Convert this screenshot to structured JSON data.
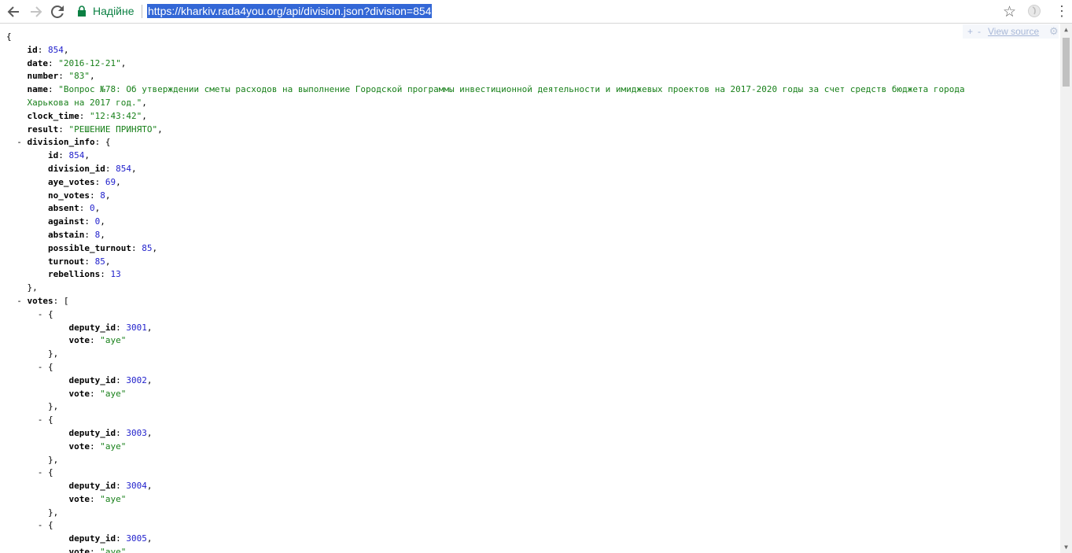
{
  "browser": {
    "secure_label": "Надійне",
    "url": "https://kharkiv.rada4you.org/api/division.json?division=854"
  },
  "viewsource": {
    "plus": "+",
    "minus": "-",
    "link": "View source"
  },
  "json_lines": [
    [
      [
        "p",
        "{"
      ]
    ],
    [
      [
        "p",
        "    "
      ],
      [
        "k",
        "id"
      ],
      [
        "p",
        ": "
      ],
      [
        "n",
        "854"
      ],
      [
        "p",
        ","
      ]
    ],
    [
      [
        "p",
        "    "
      ],
      [
        "k",
        "date"
      ],
      [
        "p",
        ": "
      ],
      [
        "s",
        "\"2016-12-21\""
      ],
      [
        "p",
        ","
      ]
    ],
    [
      [
        "p",
        "    "
      ],
      [
        "k",
        "number"
      ],
      [
        "p",
        ": "
      ],
      [
        "s",
        "\"83\""
      ],
      [
        "p",
        ","
      ]
    ],
    [
      [
        "p",
        "    "
      ],
      [
        "k",
        "name"
      ],
      [
        "p",
        ": "
      ],
      [
        "s",
        "\"Вопрос №78: Об утверждении сметы расходов на выполнение Городской программы инвестиционной деятельности и имиджевых проектов на 2017-2020 годы за счет средств бюджета города"
      ]
    ],
    [
      [
        "p",
        "    "
      ],
      [
        "s",
        "Харькова на 2017 год.\""
      ],
      [
        "p",
        ","
      ]
    ],
    [
      [
        "p",
        "    "
      ],
      [
        "k",
        "clock_time"
      ],
      [
        "p",
        ": "
      ],
      [
        "s",
        "\"12:43:42\""
      ],
      [
        "p",
        ","
      ]
    ],
    [
      [
        "p",
        "    "
      ],
      [
        "k",
        "result"
      ],
      [
        "p",
        ": "
      ],
      [
        "s",
        "\"РЕШЕНИЕ ПРИНЯТО\""
      ],
      [
        "p",
        ","
      ]
    ],
    [
      [
        "p",
        "  "
      ],
      [
        "t",
        "-"
      ],
      [
        "p",
        " "
      ],
      [
        "k",
        "division_info"
      ],
      [
        "p",
        ": {"
      ]
    ],
    [
      [
        "p",
        "        "
      ],
      [
        "k",
        "id"
      ],
      [
        "p",
        ": "
      ],
      [
        "n",
        "854"
      ],
      [
        "p",
        ","
      ]
    ],
    [
      [
        "p",
        "        "
      ],
      [
        "k",
        "division_id"
      ],
      [
        "p",
        ": "
      ],
      [
        "n",
        "854"
      ],
      [
        "p",
        ","
      ]
    ],
    [
      [
        "p",
        "        "
      ],
      [
        "k",
        "aye_votes"
      ],
      [
        "p",
        ": "
      ],
      [
        "n",
        "69"
      ],
      [
        "p",
        ","
      ]
    ],
    [
      [
        "p",
        "        "
      ],
      [
        "k",
        "no_votes"
      ],
      [
        "p",
        ": "
      ],
      [
        "n",
        "8"
      ],
      [
        "p",
        ","
      ]
    ],
    [
      [
        "p",
        "        "
      ],
      [
        "k",
        "absent"
      ],
      [
        "p",
        ": "
      ],
      [
        "n",
        "0"
      ],
      [
        "p",
        ","
      ]
    ],
    [
      [
        "p",
        "        "
      ],
      [
        "k",
        "against"
      ],
      [
        "p",
        ": "
      ],
      [
        "n",
        "0"
      ],
      [
        "p",
        ","
      ]
    ],
    [
      [
        "p",
        "        "
      ],
      [
        "k",
        "abstain"
      ],
      [
        "p",
        ": "
      ],
      [
        "n",
        "8"
      ],
      [
        "p",
        ","
      ]
    ],
    [
      [
        "p",
        "        "
      ],
      [
        "k",
        "possible_turnout"
      ],
      [
        "p",
        ": "
      ],
      [
        "n",
        "85"
      ],
      [
        "p",
        ","
      ]
    ],
    [
      [
        "p",
        "        "
      ],
      [
        "k",
        "turnout"
      ],
      [
        "p",
        ": "
      ],
      [
        "n",
        "85"
      ],
      [
        "p",
        ","
      ]
    ],
    [
      [
        "p",
        "        "
      ],
      [
        "k",
        "rebellions"
      ],
      [
        "p",
        ": "
      ],
      [
        "n",
        "13"
      ]
    ],
    [
      [
        "p",
        "    },"
      ]
    ],
    [
      [
        "p",
        "  "
      ],
      [
        "t",
        "-"
      ],
      [
        "p",
        " "
      ],
      [
        "k",
        "votes"
      ],
      [
        "p",
        ": ["
      ]
    ],
    [
      [
        "p",
        "      "
      ],
      [
        "t",
        "-"
      ],
      [
        "p",
        " {"
      ]
    ],
    [
      [
        "p",
        "            "
      ],
      [
        "k",
        "deputy_id"
      ],
      [
        "p",
        ": "
      ],
      [
        "n",
        "3001"
      ],
      [
        "p",
        ","
      ]
    ],
    [
      [
        "p",
        "            "
      ],
      [
        "k",
        "vote"
      ],
      [
        "p",
        ": "
      ],
      [
        "s",
        "\"aye\""
      ]
    ],
    [
      [
        "p",
        "        },"
      ]
    ],
    [
      [
        "p",
        "      "
      ],
      [
        "t",
        "-"
      ],
      [
        "p",
        " {"
      ]
    ],
    [
      [
        "p",
        "            "
      ],
      [
        "k",
        "deputy_id"
      ],
      [
        "p",
        ": "
      ],
      [
        "n",
        "3002"
      ],
      [
        "p",
        ","
      ]
    ],
    [
      [
        "p",
        "            "
      ],
      [
        "k",
        "vote"
      ],
      [
        "p",
        ": "
      ],
      [
        "s",
        "\"aye\""
      ]
    ],
    [
      [
        "p",
        "        },"
      ]
    ],
    [
      [
        "p",
        "      "
      ],
      [
        "t",
        "-"
      ],
      [
        "p",
        " {"
      ]
    ],
    [
      [
        "p",
        "            "
      ],
      [
        "k",
        "deputy_id"
      ],
      [
        "p",
        ": "
      ],
      [
        "n",
        "3003"
      ],
      [
        "p",
        ","
      ]
    ],
    [
      [
        "p",
        "            "
      ],
      [
        "k",
        "vote"
      ],
      [
        "p",
        ": "
      ],
      [
        "s",
        "\"aye\""
      ]
    ],
    [
      [
        "p",
        "        },"
      ]
    ],
    [
      [
        "p",
        "      "
      ],
      [
        "t",
        "-"
      ],
      [
        "p",
        " {"
      ]
    ],
    [
      [
        "p",
        "            "
      ],
      [
        "k",
        "deputy_id"
      ],
      [
        "p",
        ": "
      ],
      [
        "n",
        "3004"
      ],
      [
        "p",
        ","
      ]
    ],
    [
      [
        "p",
        "            "
      ],
      [
        "k",
        "vote"
      ],
      [
        "p",
        ": "
      ],
      [
        "s",
        "\"aye\""
      ]
    ],
    [
      [
        "p",
        "        },"
      ]
    ],
    [
      [
        "p",
        "      "
      ],
      [
        "t",
        "-"
      ],
      [
        "p",
        " {"
      ]
    ],
    [
      [
        "p",
        "            "
      ],
      [
        "k",
        "deputy_id"
      ],
      [
        "p",
        ": "
      ],
      [
        "n",
        "3005"
      ],
      [
        "p",
        ","
      ]
    ],
    [
      [
        "p",
        "            "
      ],
      [
        "k",
        "vote"
      ],
      [
        "p",
        ": "
      ],
      [
        "s",
        "\"aye\""
      ]
    ]
  ],
  "colors": {
    "string": "#18801a",
    "number": "#2222cc",
    "secure": "#0b8043",
    "url_highlight": "#3367d6"
  },
  "icons": {
    "back": "back-arrow-icon",
    "forward": "forward-arrow-icon",
    "reload": "reload-icon",
    "lock": "lock-icon",
    "bookmark": "star-icon",
    "extension": "extension-icon",
    "menu": "kebab-menu-icon",
    "settings": "gear-icon"
  }
}
